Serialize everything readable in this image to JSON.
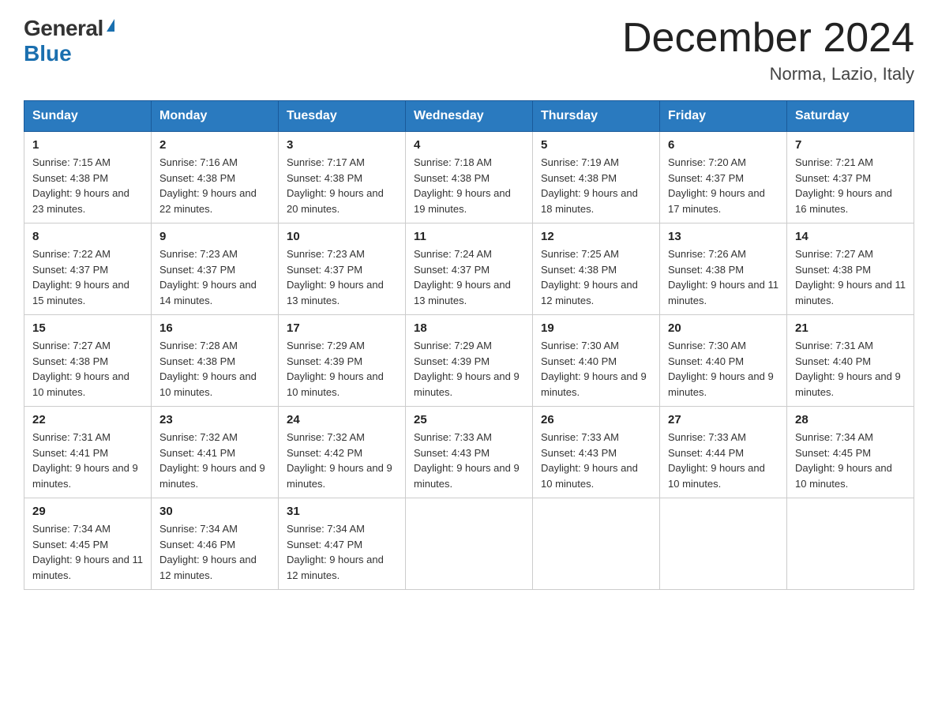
{
  "logo": {
    "general": "General",
    "blue": "Blue"
  },
  "title": "December 2024",
  "location": "Norma, Lazio, Italy",
  "days_of_week": [
    "Sunday",
    "Monday",
    "Tuesday",
    "Wednesday",
    "Thursday",
    "Friday",
    "Saturday"
  ],
  "weeks": [
    [
      {
        "day": "1",
        "sunrise": "7:15 AM",
        "sunset": "4:38 PM",
        "daylight": "9 hours and 23 minutes."
      },
      {
        "day": "2",
        "sunrise": "7:16 AM",
        "sunset": "4:38 PM",
        "daylight": "9 hours and 22 minutes."
      },
      {
        "day": "3",
        "sunrise": "7:17 AM",
        "sunset": "4:38 PM",
        "daylight": "9 hours and 20 minutes."
      },
      {
        "day": "4",
        "sunrise": "7:18 AM",
        "sunset": "4:38 PM",
        "daylight": "9 hours and 19 minutes."
      },
      {
        "day": "5",
        "sunrise": "7:19 AM",
        "sunset": "4:38 PM",
        "daylight": "9 hours and 18 minutes."
      },
      {
        "day": "6",
        "sunrise": "7:20 AM",
        "sunset": "4:37 PM",
        "daylight": "9 hours and 17 minutes."
      },
      {
        "day": "7",
        "sunrise": "7:21 AM",
        "sunset": "4:37 PM",
        "daylight": "9 hours and 16 minutes."
      }
    ],
    [
      {
        "day": "8",
        "sunrise": "7:22 AM",
        "sunset": "4:37 PM",
        "daylight": "9 hours and 15 minutes."
      },
      {
        "day": "9",
        "sunrise": "7:23 AM",
        "sunset": "4:37 PM",
        "daylight": "9 hours and 14 minutes."
      },
      {
        "day": "10",
        "sunrise": "7:23 AM",
        "sunset": "4:37 PM",
        "daylight": "9 hours and 13 minutes."
      },
      {
        "day": "11",
        "sunrise": "7:24 AM",
        "sunset": "4:37 PM",
        "daylight": "9 hours and 13 minutes."
      },
      {
        "day": "12",
        "sunrise": "7:25 AM",
        "sunset": "4:38 PM",
        "daylight": "9 hours and 12 minutes."
      },
      {
        "day": "13",
        "sunrise": "7:26 AM",
        "sunset": "4:38 PM",
        "daylight": "9 hours and 11 minutes."
      },
      {
        "day": "14",
        "sunrise": "7:27 AM",
        "sunset": "4:38 PM",
        "daylight": "9 hours and 11 minutes."
      }
    ],
    [
      {
        "day": "15",
        "sunrise": "7:27 AM",
        "sunset": "4:38 PM",
        "daylight": "9 hours and 10 minutes."
      },
      {
        "day": "16",
        "sunrise": "7:28 AM",
        "sunset": "4:38 PM",
        "daylight": "9 hours and 10 minutes."
      },
      {
        "day": "17",
        "sunrise": "7:29 AM",
        "sunset": "4:39 PM",
        "daylight": "9 hours and 10 minutes."
      },
      {
        "day": "18",
        "sunrise": "7:29 AM",
        "sunset": "4:39 PM",
        "daylight": "9 hours and 9 minutes."
      },
      {
        "day": "19",
        "sunrise": "7:30 AM",
        "sunset": "4:40 PM",
        "daylight": "9 hours and 9 minutes."
      },
      {
        "day": "20",
        "sunrise": "7:30 AM",
        "sunset": "4:40 PM",
        "daylight": "9 hours and 9 minutes."
      },
      {
        "day": "21",
        "sunrise": "7:31 AM",
        "sunset": "4:40 PM",
        "daylight": "9 hours and 9 minutes."
      }
    ],
    [
      {
        "day": "22",
        "sunrise": "7:31 AM",
        "sunset": "4:41 PM",
        "daylight": "9 hours and 9 minutes."
      },
      {
        "day": "23",
        "sunrise": "7:32 AM",
        "sunset": "4:41 PM",
        "daylight": "9 hours and 9 minutes."
      },
      {
        "day": "24",
        "sunrise": "7:32 AM",
        "sunset": "4:42 PM",
        "daylight": "9 hours and 9 minutes."
      },
      {
        "day": "25",
        "sunrise": "7:33 AM",
        "sunset": "4:43 PM",
        "daylight": "9 hours and 9 minutes."
      },
      {
        "day": "26",
        "sunrise": "7:33 AM",
        "sunset": "4:43 PM",
        "daylight": "9 hours and 10 minutes."
      },
      {
        "day": "27",
        "sunrise": "7:33 AM",
        "sunset": "4:44 PM",
        "daylight": "9 hours and 10 minutes."
      },
      {
        "day": "28",
        "sunrise": "7:34 AM",
        "sunset": "4:45 PM",
        "daylight": "9 hours and 10 minutes."
      }
    ],
    [
      {
        "day": "29",
        "sunrise": "7:34 AM",
        "sunset": "4:45 PM",
        "daylight": "9 hours and 11 minutes."
      },
      {
        "day": "30",
        "sunrise": "7:34 AM",
        "sunset": "4:46 PM",
        "daylight": "9 hours and 12 minutes."
      },
      {
        "day": "31",
        "sunrise": "7:34 AM",
        "sunset": "4:47 PM",
        "daylight": "9 hours and 12 minutes."
      },
      null,
      null,
      null,
      null
    ]
  ]
}
